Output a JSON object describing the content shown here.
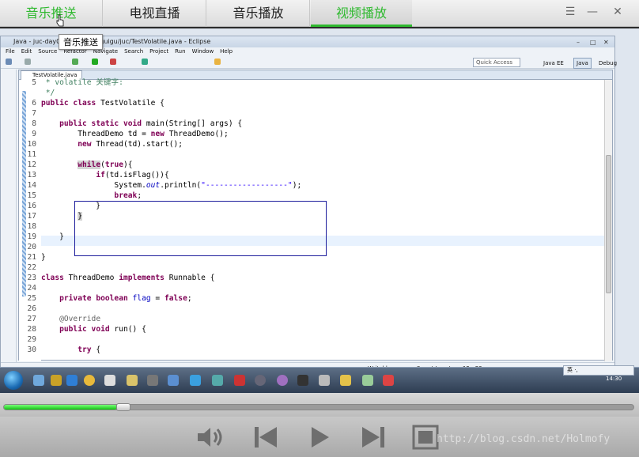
{
  "player": {
    "tabs": [
      {
        "label": "音乐推送",
        "active": true
      },
      {
        "label": "电视直播",
        "active": false
      },
      {
        "label": "音乐播放",
        "active": false
      },
      {
        "label": "视频播放",
        "active": false
      }
    ],
    "window_controls": {
      "menu": "☰",
      "minimize": "—",
      "close": "✕"
    },
    "tooltip": "音乐推送",
    "progress_fraction": 0.18,
    "watermark": "http://blog.csdn.net/Holmofy",
    "accent_color": "#2fb92f"
  },
  "eclipse": {
    "title": "Java - juc-day01/src/com/atguigu/juc/TestVolatile.java - Eclipse",
    "menu": [
      "File",
      "Edit",
      "Source",
      "Refactor",
      "Navigate",
      "Search",
      "Project",
      "Run",
      "Window",
      "Help"
    ],
    "quick_access": "Quick Access",
    "perspectives": [
      "Java EE",
      "Java",
      "Debug"
    ],
    "editor_tab": "TestVolatile.java",
    "code_lines": [
      {
        "n": "5",
        "html": "<span class='cmt'> * volatile 关键字:</span>"
      },
      {
        "n": "",
        "html": "<span class='cmt'> */</span>"
      },
      {
        "n": "6",
        "html": "<span class='kw'>public class</span> TestVolatile {"
      },
      {
        "n": "7",
        "html": ""
      },
      {
        "n": "8",
        "html": "    <span class='kw'>public static void</span> main(String[] args) {"
      },
      {
        "n": "9",
        "html": "        ThreadDemo td = <span class='kw'>new</span> ThreadDemo();"
      },
      {
        "n": "10",
        "html": "        <span class='kw'>new</span> Thread(td).start();"
      },
      {
        "n": "11",
        "html": ""
      },
      {
        "n": "12",
        "html": "        <span class='kw hl'>while</span>(<span class='kw'>true</span>){"
      },
      {
        "n": "13",
        "html": "            <span class='kw'>if</span>(td.isFlag()){"
      },
      {
        "n": "14",
        "html": "                System.<span class='fld'>out</span>.println(<span class='str'>\"------------------\"</span>);"
      },
      {
        "n": "15",
        "html": "                <span class='kw'>break</span>;"
      },
      {
        "n": "16",
        "html": "            }"
      },
      {
        "n": "17",
        "html": "        <span class='hl'>}</span>"
      },
      {
        "n": "18",
        "html": ""
      },
      {
        "n": "19",
        "html": "    }"
      },
      {
        "n": "20",
        "html": ""
      },
      {
        "n": "21",
        "html": "}"
      },
      {
        "n": "22",
        "html": ""
      },
      {
        "n": "23",
        "html": "<span class='kw'>class</span> ThreadDemo <span class='kw'>implements</span> Runnable {"
      },
      {
        "n": "24",
        "html": ""
      },
      {
        "n": "25",
        "html": "    <span class='kw'>private boolean</span> <span class='fld' style='font-style:normal'>flag</span> = <span class='kw'>false</span>;"
      },
      {
        "n": "26",
        "html": ""
      },
      {
        "n": "27",
        "html": "    <span class='ann'>@Override</span>"
      },
      {
        "n": "28",
        "html": "    <span class='kw'>public void</span> run() {"
      },
      {
        "n": "29",
        "html": ""
      },
      {
        "n": "30",
        "html": "        <span class='kw'>try</span> {"
      }
    ],
    "status": {
      "writable": "Writable",
      "insert": "Smart Insert",
      "position": "15 : 23"
    },
    "ime": "英 ·,",
    "clock": "14:30"
  }
}
